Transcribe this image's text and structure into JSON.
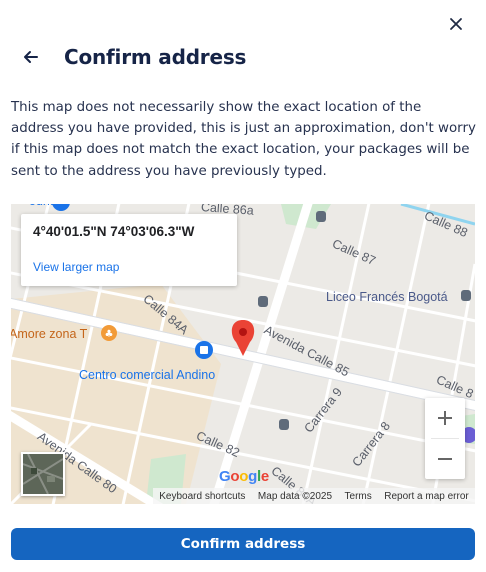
{
  "header": {
    "title": "Confirm address"
  },
  "description": "This map does not necessarily show the exact location of the address you have provided, this is just an approximation, don't worry if this map does not match the exact location, your packages will be sent to the address you have previously typed.",
  "map": {
    "coordinates": "4°40'01.5\"N 74°03'06.3\"W",
    "view_larger": "View larger map",
    "streets": {
      "calle_86a": "Calle 86a",
      "calle_87": "Calle 87",
      "calle_88": "Calle 88",
      "calle_84a": "Calle 84A",
      "avenida_calle_85": "Avenida Calle 85",
      "carrera_9": "Carrera 9",
      "calle_82": "Calle 82",
      "calle_84a_2": "Calle 84A",
      "carrera_8": "Carrera 8",
      "avenida_calle_80": "Avenida Calle 80",
      "calle_8": "Calle 8",
      "country": "ountry"
    },
    "pois": {
      "liceo": "Liceo Francés Bogotá",
      "amore": "Amore zona T",
      "andino": "Centro comercial Andino"
    },
    "google": "Google",
    "footer": {
      "shortcuts": "Keyboard shortcuts",
      "map_data": "Map data ©2025",
      "terms": "Terms",
      "report": "Report a map error"
    },
    "pin_color": "#ea4335"
  },
  "confirm_button": "Confirm address",
  "colors": {
    "primary": "#1565c0",
    "title": "#162447"
  }
}
